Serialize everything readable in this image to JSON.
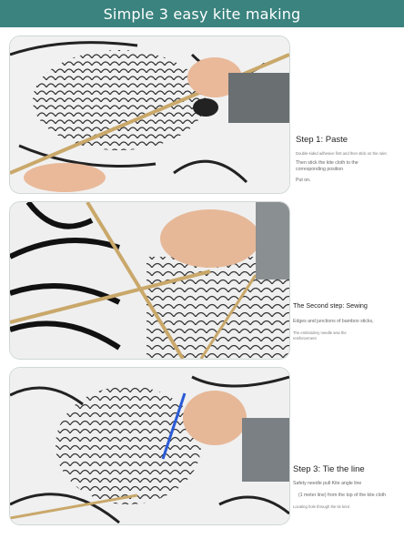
{
  "header": {
    "title": "Simple 3 easy kite making"
  },
  "steps": [
    {
      "title": "Step 1: Paste",
      "lines": [
        "Double-sided adhesive first and then stick on the ruler.",
        "Then stick the kite cloth to the",
        "corresponding position",
        "Put on."
      ]
    },
    {
      "title": "The Second step: Sewing",
      "lines": [
        "Edges and junctions of bamboo sticks,",
        "The embroidery needle sew the",
        "reinforcement"
      ]
    },
    {
      "title": "Step 3: Tie the line",
      "lines": [
        "Safety needle pull Kite angle line",
        "(1 meter line) from the top of the kite cloth",
        "Locating hole through the tie knot"
      ]
    }
  ],
  "colors": {
    "header_bg": "#3a837e",
    "header_text": "#ffffff"
  },
  "icons": [
    "paste-photo",
    "sewing-photo",
    "tie-line-photo"
  ]
}
